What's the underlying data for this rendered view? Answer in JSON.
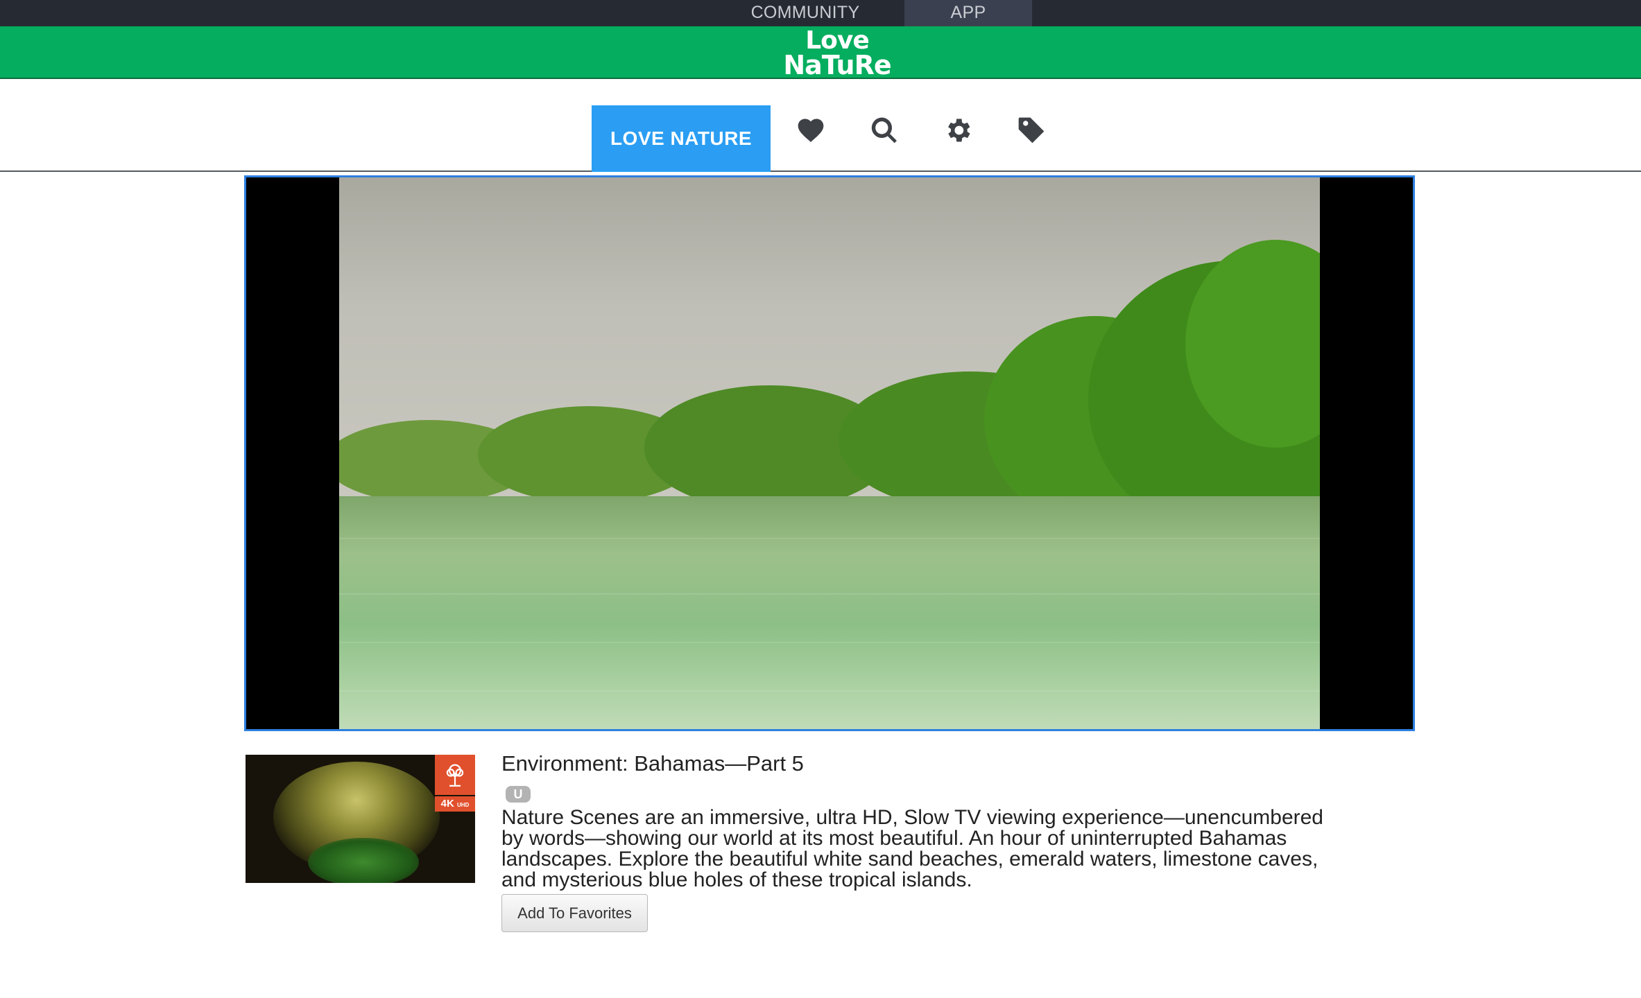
{
  "top_tabs": [
    {
      "label": "COMMUNITY"
    },
    {
      "label": "APP"
    }
  ],
  "brand": {
    "logo_line1": "Love",
    "logo_line2": "NaTuRe",
    "color": "#05ad5e"
  },
  "nav": {
    "active_label": "LOVE NATURE",
    "active_color": "#2b9ef3",
    "icons": [
      "heart-icon",
      "search-icon",
      "gear-icon",
      "tag-icon"
    ]
  },
  "player": {
    "border_color": "#2d7fe0"
  },
  "program": {
    "title": "Environment: Bahamas—Part 5",
    "rating": "U",
    "thumbnail_badge": "4K",
    "thumbnail_badge_sub": "UHD",
    "description": "Nature Scenes are an immersive, ultra HD, Slow TV viewing experience—unencumbered by words—showing our world at its most beautiful. An hour of uninterrupted Bahamas landscapes. Explore the beautiful white sand beaches, emerald waters, limestone caves, and mysterious blue holes of these tropical islands.",
    "favorite_button": "Add To Favorites"
  }
}
